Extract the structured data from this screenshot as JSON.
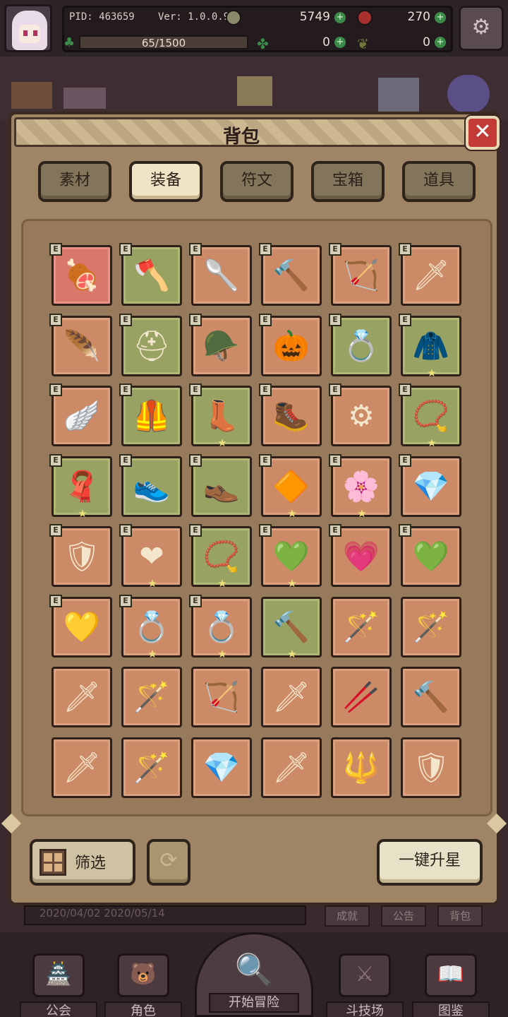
{
  "hud": {
    "pid": "PID: 463659",
    "version": "Ver: 1.0.0.9",
    "gold": "5749",
    "gems": "270",
    "xp": "65/1500",
    "clover": "0",
    "leaf": "0",
    "plus": "+"
  },
  "bag": {
    "title": "背包",
    "close": "✕",
    "tabs": [
      "素材",
      "装备",
      "符文",
      "宝箱",
      "道具"
    ],
    "active_tab": 1,
    "badge": "E",
    "star": "★",
    "items": [
      {
        "bg": "red",
        "icon": "🍖",
        "e": true,
        "star": false
      },
      {
        "bg": "green",
        "icon": "🪓",
        "e": true,
        "star": false
      },
      {
        "bg": "orange",
        "icon": "🥄",
        "e": true,
        "star": false
      },
      {
        "bg": "orange",
        "icon": "🔨",
        "e": true,
        "star": false
      },
      {
        "bg": "orange",
        "icon": "🏹",
        "e": true,
        "star": false
      },
      {
        "bg": "orange",
        "icon": "🗡",
        "e": true,
        "star": false
      },
      {
        "bg": "orange",
        "icon": "🪶",
        "e": true,
        "star": false
      },
      {
        "bg": "green",
        "icon": "⛑",
        "e": true,
        "star": false
      },
      {
        "bg": "orange",
        "icon": "🪖",
        "e": true,
        "star": false
      },
      {
        "bg": "orange",
        "icon": "🎃",
        "e": true,
        "star": false
      },
      {
        "bg": "green",
        "icon": "💍",
        "e": true,
        "star": false
      },
      {
        "bg": "green",
        "icon": "🧥",
        "e": true,
        "star": true
      },
      {
        "bg": "orange",
        "icon": "🪽",
        "e": true,
        "star": false
      },
      {
        "bg": "green",
        "icon": "🦺",
        "e": true,
        "star": false
      },
      {
        "bg": "green",
        "icon": "👢",
        "e": true,
        "star": true
      },
      {
        "bg": "orange",
        "icon": "🥾",
        "e": true,
        "star": false
      },
      {
        "bg": "orange",
        "icon": "⚙",
        "e": true,
        "star": false
      },
      {
        "bg": "green",
        "icon": "📿",
        "e": true,
        "star": true
      },
      {
        "bg": "green",
        "icon": "🧣",
        "e": true,
        "star": true
      },
      {
        "bg": "green",
        "icon": "👟",
        "e": true,
        "star": false
      },
      {
        "bg": "green",
        "icon": "👞",
        "e": true,
        "star": false
      },
      {
        "bg": "orange",
        "icon": "🔶",
        "e": true,
        "star": true
      },
      {
        "bg": "orange",
        "icon": "🌸",
        "e": true,
        "star": true
      },
      {
        "bg": "orange",
        "icon": "💎",
        "e": true,
        "star": false
      },
      {
        "bg": "orange",
        "icon": "🛡",
        "e": true,
        "star": false
      },
      {
        "bg": "orange",
        "icon": "❤",
        "e": true,
        "star": true
      },
      {
        "bg": "green",
        "icon": "📿",
        "e": true,
        "star": true
      },
      {
        "bg": "orange",
        "icon": "💚",
        "e": true,
        "star": true
      },
      {
        "bg": "orange",
        "icon": "💗",
        "e": true,
        "star": false
      },
      {
        "bg": "orange",
        "icon": "💚",
        "e": true,
        "star": false
      },
      {
        "bg": "orange",
        "icon": "💛",
        "e": true,
        "star": false
      },
      {
        "bg": "orange",
        "icon": "💍",
        "e": true,
        "star": true
      },
      {
        "bg": "orange",
        "icon": "💍",
        "e": true,
        "star": true
      },
      {
        "bg": "green",
        "icon": "🔨",
        "e": false,
        "star": true
      },
      {
        "bg": "orange",
        "icon": "🪄",
        "e": false,
        "star": false
      },
      {
        "bg": "orange",
        "icon": "🪄",
        "e": false,
        "star": false
      },
      {
        "bg": "orange",
        "icon": "🗡",
        "e": false,
        "star": false
      },
      {
        "bg": "orange",
        "icon": "🪄",
        "e": false,
        "star": false
      },
      {
        "bg": "orange",
        "icon": "🏹",
        "e": false,
        "star": false
      },
      {
        "bg": "orange",
        "icon": "🗡",
        "e": false,
        "star": false
      },
      {
        "bg": "orange",
        "icon": "🥢",
        "e": false,
        "star": false
      },
      {
        "bg": "orange",
        "icon": "🔨",
        "e": false,
        "star": false
      },
      {
        "bg": "orange",
        "icon": "🗡",
        "e": false,
        "star": false
      },
      {
        "bg": "orange",
        "icon": "🪄",
        "e": false,
        "star": false
      },
      {
        "bg": "orange",
        "icon": "💎",
        "e": false,
        "star": false
      },
      {
        "bg": "orange",
        "icon": "🗡",
        "e": false,
        "star": false
      },
      {
        "bg": "orange",
        "icon": "🔱",
        "e": false,
        "star": false
      },
      {
        "bg": "orange",
        "icon": "🛡",
        "e": false,
        "star": false
      }
    ],
    "filter": "筛选",
    "refresh": "⟳",
    "upgrade_all": "一键升星"
  },
  "under": {
    "dates": "2020/04/02   2020/05/14",
    "achievements": "成就",
    "announcement": "公告",
    "bag": "背包"
  },
  "nav": {
    "guild": "公会",
    "character": "角色",
    "adventure": "开始冒险",
    "arena": "斗技场",
    "codex": "图鉴"
  },
  "colors": {
    "slot_orange": "#cd8a66",
    "slot_green": "#98a262",
    "slot_red": "#d8776a",
    "close_red": "#c23b36",
    "panel": "#a08466"
  }
}
